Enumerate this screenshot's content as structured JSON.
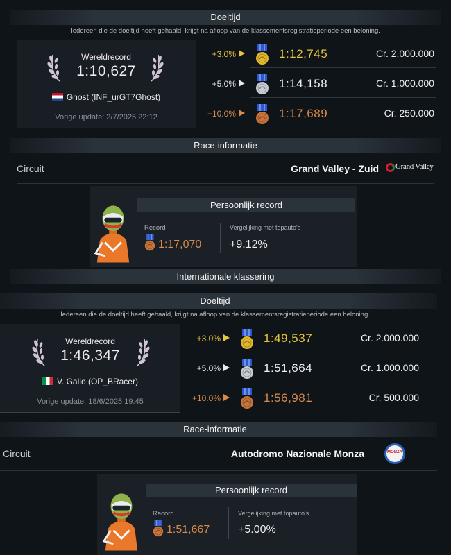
{
  "sections": [
    {
      "target": {
        "header": "Doeltijd",
        "subtitle": "Iedereen die de doeltijd heeft gehaald, krijgt na afloop van de klassementsregistratieperiode een beloning.",
        "wr_label": "Wereldrecord",
        "wr_time": "1:10,627",
        "wr_holder": "Ghost (INF_urGT7Ghost)",
        "wr_flag": "netherlands-flag",
        "update": "Vorige update: 2/7/2025 22:12",
        "rows": [
          {
            "pct": "+3.0%",
            "time": "1:12,745",
            "credits": "Cr.  2.000.000",
            "medal": "gold"
          },
          {
            "pct": "+5.0%",
            "time": "1:14,158",
            "credits": "Cr.  1.000.000",
            "medal": "silver"
          },
          {
            "pct": "+10.0%",
            "time": "1:17,689",
            "credits": "Cr.  250.000",
            "medal": "bronze"
          }
        ]
      },
      "race_info": {
        "header": "Race-informatie",
        "circuit_label": "Circuit",
        "circuit_name": "Grand Valley - Zuid",
        "logo_text": "Grand Valley"
      },
      "personal": {
        "header": "Persoonlijk record",
        "record_label": "Record",
        "record_time": "1:17,070",
        "compare_label": "Vergelijking met topauto's",
        "compare_value": "+9.12%"
      }
    },
    {
      "ranking_header": "Internationale klassering",
      "target": {
        "header": "Doeltijd",
        "subtitle": "Iedereen die de doeltijd heeft gehaald, krijgt na afloop van de klassementsregistratieperiode een beloning.",
        "wr_label": "Wereldrecord",
        "wr_time": "1:46,347",
        "wr_holder": "V. Gallo (OP_BRacer)",
        "wr_flag": "italy-flag",
        "update": "Vorige update: 18/6/2025 19:45",
        "rows": [
          {
            "pct": "+3.0%",
            "time": "1:49,537",
            "credits": "Cr.  2.000.000",
            "medal": "gold"
          },
          {
            "pct": "+5.0%",
            "time": "1:51,664",
            "credits": "Cr.  1.000.000",
            "medal": "silver"
          },
          {
            "pct": "+10.0%",
            "time": "1:56,981",
            "credits": "Cr.  500.000",
            "medal": "bronze"
          }
        ]
      },
      "race_info": {
        "header": "Race-informatie",
        "circuit_label": "Circuit",
        "circuit_name": "Autodromo Nazionale Monza",
        "logo_text": "MONZA"
      },
      "personal": {
        "header": "Persoonlijk record",
        "record_label": "Record",
        "record_time": "1:51,667",
        "compare_label": "Vergelijking met topauto's",
        "compare_value": "+5.00%"
      }
    }
  ],
  "colors": {
    "gold": "#e8c53a",
    "silver": "#e0e4e8",
    "bronze": "#d9894a",
    "wr": "#f0e8f0"
  }
}
